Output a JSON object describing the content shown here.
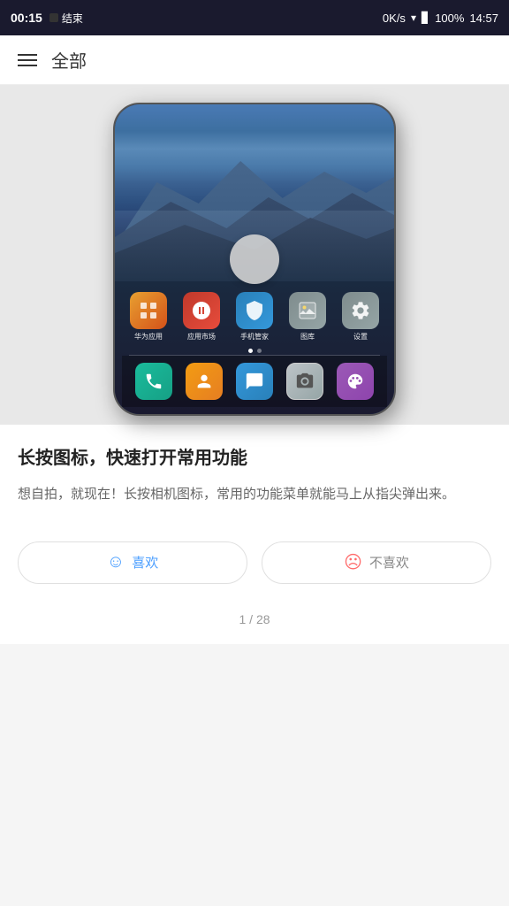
{
  "statusBar": {
    "time": "00:15",
    "recordLabel": "结束",
    "networkSpeed": "0K/s",
    "battery": "100%",
    "clockTime": "14:57"
  },
  "header": {
    "title": "全部"
  },
  "phoneScreen": {
    "apps": [
      [
        {
          "label": "华为应用",
          "iconClass": "icon-huawei-apps",
          "symbol": "◉"
        },
        {
          "label": "应用市场",
          "iconClass": "icon-app-store",
          "symbol": "🌸"
        },
        {
          "label": "手机管家",
          "iconClass": "icon-phone-manager",
          "symbol": "🛡"
        },
        {
          "label": "图库",
          "iconClass": "icon-gallery",
          "symbol": "🖼"
        },
        {
          "label": "设置",
          "iconClass": "icon-settings",
          "symbol": "⚙"
        }
      ]
    ],
    "dockApps": [
      {
        "label": "",
        "iconClass": "icon-phone",
        "symbol": "📞"
      },
      {
        "label": "",
        "iconClass": "icon-contacts",
        "symbol": "👤"
      },
      {
        "label": "",
        "iconClass": "icon-messages",
        "symbol": "💬"
      },
      {
        "label": "",
        "iconClass": "icon-camera",
        "symbol": "📷"
      },
      {
        "label": "",
        "iconClass": "icon-themes",
        "symbol": "✦"
      }
    ]
  },
  "tip": {
    "title": "长按图标，快速打开常用功能",
    "description": "想自拍，就现在！长按相机图标，常用的功能菜单就能马上从指尖弹出来。"
  },
  "buttons": {
    "like": "喜欢",
    "dislike": "不喜欢"
  },
  "pagination": {
    "current": "1",
    "total": "28",
    "separator": "/",
    "display": "1 / 28"
  }
}
